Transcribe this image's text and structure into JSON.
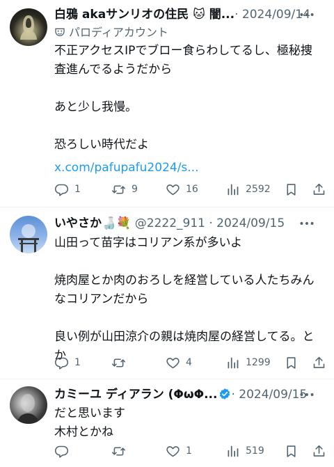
{
  "tweets": [
    {
      "name": "白鴉 akaサンリオの住民 🐱 闇...",
      "meta": "· 2024/09/14",
      "sublabel": "パロディアカウント",
      "body": "不正アクセスIPでブロー食らわしてるし、極秘捜\n査進んでるようだから\n\nあと少し我慢。\n\n恐ろしい時代だよ",
      "link": "x.com/pafupafu2024/s...",
      "counts": {
        "reply": "1",
        "repost": "9",
        "like": "16",
        "views": "2592"
      }
    },
    {
      "name": "いやさか🍶💐",
      "meta": "@2222_911 · 2024/09/15",
      "body": "山田って苗字はコリアン系が多いよ\n\n焼肉屋とか肉のおろしを経営している人たちみん\nなコリアンだから\n\n良い例が山田涼介の親は焼肉屋の経営してる。と\nか",
      "counts": {
        "reply": "1",
        "repost": "",
        "like": "4",
        "views": "1299"
      }
    },
    {
      "name": "カミーユ ディアラン (ΦωΦ...",
      "meta": "· 2024/09/15",
      "body": "だと思います\n木村とかね",
      "counts": {
        "reply": "",
        "repost": "",
        "like": "1",
        "views": "519"
      }
    }
  ],
  "icons": [
    "more-icon",
    "reply-icon",
    "repost-icon",
    "like-icon",
    "views-icon",
    "bookmark-icon",
    "share-icon",
    "parody-mask-icon",
    "verified-icon"
  ],
  "colors": {
    "text": "#0f1419",
    "secondary": "#536471",
    "link": "#1d9bf0",
    "divider": "#eff3f4"
  }
}
